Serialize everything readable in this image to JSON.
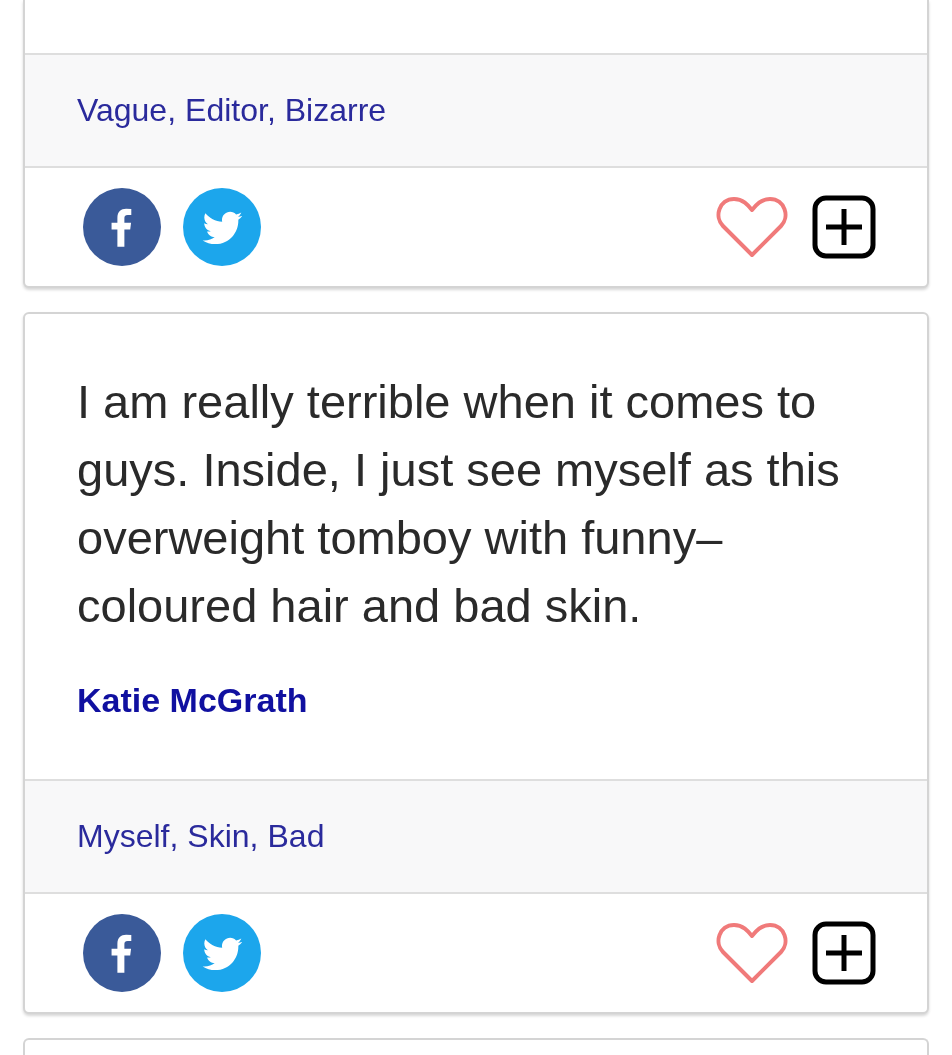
{
  "cards": [
    {
      "kind": "quote",
      "tags": [
        "Vague,",
        "Editor,",
        "Bizarre"
      ],
      "liked": false
    },
    {
      "kind": "quote",
      "quote": "I am really terrible when it comes to guys. Inside, I just see myself as this overweight tomboy with funny–coloured hair and bad skin.",
      "author": "Katie McGrath",
      "tags": [
        "Myself,",
        "Skin,",
        "Bad"
      ],
      "liked": false
    },
    {
      "kind": "quote"
    }
  ]
}
